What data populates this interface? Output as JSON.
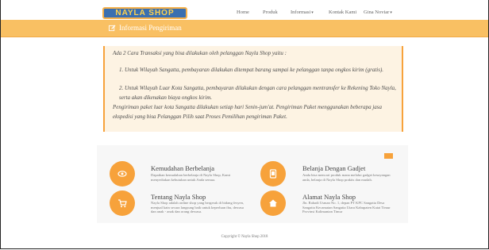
{
  "logo": {
    "text": "NAYLA SHOP"
  },
  "nav": {
    "items": [
      {
        "label": "Home",
        "dropdown": false
      },
      {
        "label": "Produk",
        "dropdown": false
      },
      {
        "label": "Informasi",
        "dropdown": true
      },
      {
        "label": "Kontak Kami",
        "dropdown": false
      },
      {
        "label": "Gina Noviar",
        "dropdown": true
      }
    ]
  },
  "banner": {
    "title": "Informasi Pengiriman",
    "icon": "edit-icon"
  },
  "info": {
    "intro": "Ada 2 Cara Transaksi yang bisa dilakukan oleh pelanggan Nayla Shop yaitu :",
    "item1": "Untuk Wilayah Sangatta, pembayaran dilakukan ditempat barang sampai ke pelanggan tanpa ongkos kirim (gratis).",
    "item2": "Untuk Wilayah Luar Kota Sangatta, pembayaran dilakukan dengan cara pelanggan mentransfer ke Rekening Toko Nayla, serta akan dikenakan biaya ongkos kirim.",
    "outro": "Pengiriman paket luar kota Sangatta dilakukan setiap hari Senin-jum'at. Pengiriman Paket menggunakan beberapa jasa ekspedisi yang bisa Pelanggan Pilih saat Proses Pemilihan pengiriman Paket."
  },
  "features": [
    {
      "icon": "eye-icon",
      "title": "Kemudahan Berbelanja",
      "desc": "Dapatkan kemudahan berbelanja di Nayla Shop, Kami menyediakan kebutuhan untuk Anda semua."
    },
    {
      "icon": "tablet-icon",
      "title": "Belanja Dengan Gadjet",
      "desc": "Anda bisa mencari produk mana melalui gadget kesayangan anda, belanja di Nayla Shop praktis dan mudah."
    },
    {
      "icon": "cart-icon",
      "title": "Tentang Nayla Shop",
      "desc": "Nayla Shop adalah online shop yang bergerak di bidang fesyen, menjual kain secara langsung baik untuk keperluan ibu, dewasa dan anak - anak dan orang dewasa."
    },
    {
      "icon": "home-icon",
      "title": "Alamat Nayla Shop",
      "desc": "Jln. Rahadi Usman No. 1, depan PT KPC Sangatta Desa Sangatta Kecamatan Sangatta Utara Kabupaten Kutai Timur Provinsi Kalimantan Timur"
    }
  ],
  "footer": {
    "text": "Copyright © Nayla Shop 2018"
  },
  "colors": {
    "accent": "#f7a23b",
    "band": "#f9c063",
    "card_bg": "#fdf3e3"
  }
}
